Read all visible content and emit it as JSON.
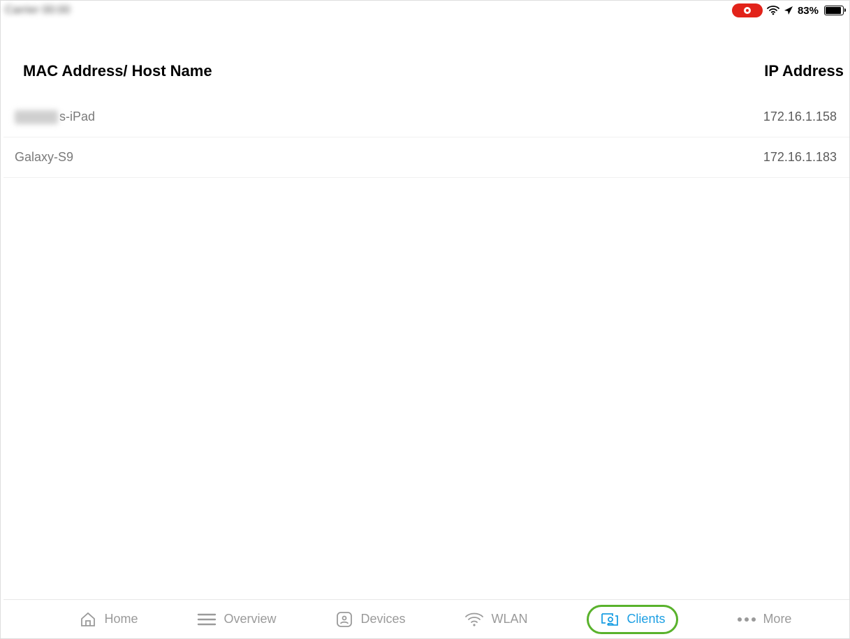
{
  "status": {
    "carrier_blurred": "Carrier 00:00",
    "battery_percent": "83%",
    "battery_fill_pct": 83
  },
  "columns": {
    "mac_host": "MAC Address/ Host Name",
    "ip": "IP Address"
  },
  "rows": [
    {
      "host_prefix_blurred": true,
      "host_suffix": "s-iPad",
      "ip": "172.16.1.158"
    },
    {
      "host_prefix_blurred": false,
      "host_suffix": "Galaxy-S9",
      "ip": "172.16.1.183"
    }
  ],
  "tabs": {
    "home": "Home",
    "overview": "Overview",
    "devices": "Devices",
    "wlan": "WLAN",
    "clients": "Clients",
    "more": "More",
    "active": "clients"
  }
}
